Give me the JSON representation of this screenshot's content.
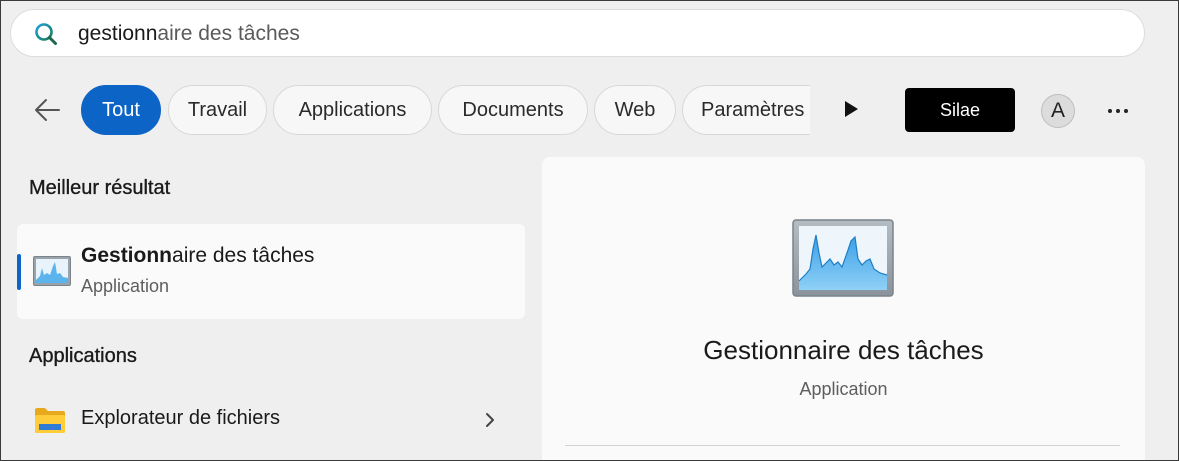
{
  "search": {
    "query_typed": "gestionn",
    "query_suggested": "aire des tâches"
  },
  "filters": [
    {
      "label": "Tout",
      "active": true
    },
    {
      "label": "Travail",
      "active": false
    },
    {
      "label": "Applications",
      "active": false
    },
    {
      "label": "Documents",
      "active": false
    },
    {
      "label": "Web",
      "active": false
    },
    {
      "label": "Paramètres",
      "active": false
    }
  ],
  "account": {
    "button_label": "Silae",
    "avatar_initial": "A"
  },
  "best_match": {
    "section_title": "Meilleur résultat",
    "name_match": "Gestionn",
    "name_rest": "aire des tâches",
    "type": "Application",
    "icon": "task-manager-icon"
  },
  "apps_section": {
    "section_title": "Applications",
    "items": [
      {
        "label": "Explorateur de fichiers",
        "icon": "folder-icon"
      }
    ]
  },
  "preview": {
    "name": "Gestionnaire des tâches",
    "type": "Application"
  },
  "colors": {
    "accent": "#0c64c6",
    "background": "#efefef",
    "card": "#fafafa"
  }
}
